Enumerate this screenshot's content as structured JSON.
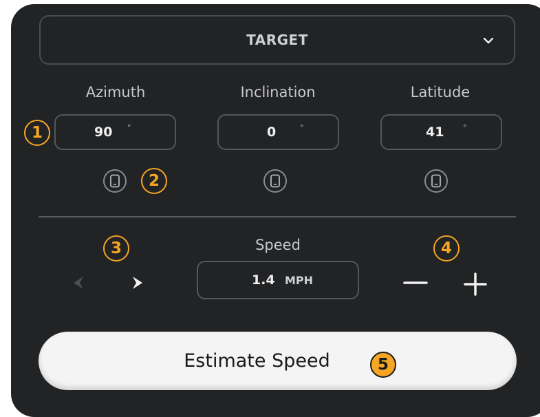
{
  "dropdown": {
    "label": "TARGET"
  },
  "columns": [
    {
      "title": "Azimuth",
      "value": "90",
      "unit": "°"
    },
    {
      "title": "Inclination",
      "value": "0",
      "unit": "°"
    },
    {
      "title": "Latitude",
      "value": "41",
      "unit": "°"
    }
  ],
  "speed": {
    "title": "Speed",
    "value": "1.4",
    "unit": "MPH"
  },
  "estimate_button": {
    "label": "Estimate Speed"
  },
  "annotations": [
    "1",
    "2",
    "3",
    "4",
    "5"
  ],
  "icons": {
    "dropdown": "chevron-down-icon",
    "phone": "phone-icon",
    "prev": "chevron-left-icon",
    "next": "chevron-right-icon",
    "minus": "minus-icon",
    "plus": "plus-icon"
  },
  "colors": {
    "panel": "#222325",
    "annotation": "#f5a623",
    "button": "#f4f4f4"
  }
}
